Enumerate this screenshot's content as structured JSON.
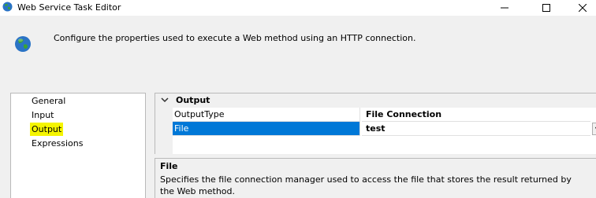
{
  "window": {
    "title": "Web Service Task Editor",
    "icon": "globe-icon"
  },
  "header": {
    "description": "Configure the properties used to execute a Web method using an HTTP connection."
  },
  "nav": {
    "items": [
      {
        "label": "General",
        "selected": false
      },
      {
        "label": "Input",
        "selected": false
      },
      {
        "label": "Output",
        "selected": true
      },
      {
        "label": "Expressions",
        "selected": false
      }
    ]
  },
  "grid": {
    "category": "Output",
    "rows": [
      {
        "name": "OutputType",
        "value": "File Connection"
      },
      {
        "name": "File",
        "value": "test",
        "selected": true
      }
    ]
  },
  "help": {
    "title": "File",
    "text": "Specifies the file connection manager used to access the file that stores the result returned by the Web method."
  },
  "colors": {
    "selection": "#0078d7",
    "nav_highlight": "#f5f500"
  }
}
